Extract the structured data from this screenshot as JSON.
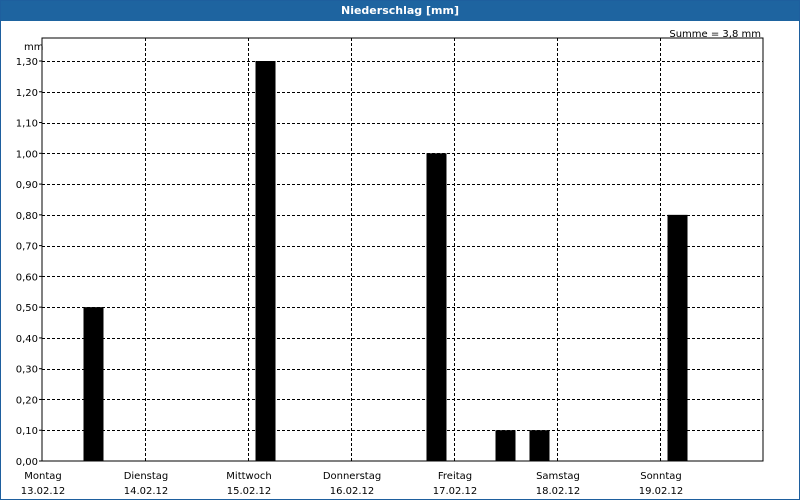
{
  "window": {
    "title": "Niederschlag [mm]"
  },
  "chart_data": {
    "type": "bar",
    "title": "Niederschlag [mm]",
    "unit_label": "mm",
    "summary": "Summe = 3,8 mm",
    "ylim": [
      0,
      1.4
    ],
    "yticks": [
      "0,00",
      "0,10",
      "0,20",
      "0,30",
      "0,40",
      "0,50",
      "0,60",
      "0,70",
      "0,80",
      "0,90",
      "1,00",
      "1,10",
      "1,20",
      "1,30"
    ],
    "xlim": [
      0,
      7
    ],
    "days": [
      {
        "name": "Montag",
        "date": "13.02.12"
      },
      {
        "name": "Dienstag",
        "date": "14.02.12"
      },
      {
        "name": "Mittwoch",
        "date": "15.02.12"
      },
      {
        "name": "Donnerstag",
        "date": "16.02.12"
      },
      {
        "name": "Freitag",
        "date": "17.02.12"
      },
      {
        "name": "Samstag",
        "date": "18.02.12"
      },
      {
        "name": "Sonntag",
        "date": "19.02.12"
      }
    ],
    "bars": [
      {
        "x": 0.5,
        "value": 0.5
      },
      {
        "x": 2.17,
        "value": 1.3
      },
      {
        "x": 3.83,
        "value": 1.0
      },
      {
        "x": 4.5,
        "value": 0.1
      },
      {
        "x": 4.83,
        "value": 0.1
      },
      {
        "x": 6.17,
        "value": 0.8
      }
    ],
    "grid": true,
    "bar_color": "#000000"
  }
}
